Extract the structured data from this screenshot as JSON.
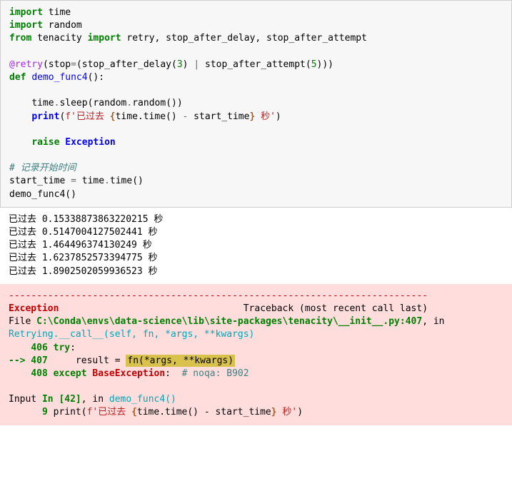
{
  "code": {
    "l1": {
      "import": "import",
      "mod": "time"
    },
    "l2": {
      "import": "import",
      "mod": "random"
    },
    "l3": {
      "from": "from",
      "mod": "tenacity",
      "import": "import",
      "names": "retry, stop_after_delay, stop_after_attempt"
    },
    "l5": {
      "decor": "@retry",
      "p1": "(stop",
      "eq": "=",
      "p2": "(stop_after_delay(",
      "n1": "3",
      "p3": ") ",
      "bar": "|",
      "p4": " stop_after_attempt(",
      "n2": "5",
      "p5": ")))"
    },
    "l6": {
      "def": "def",
      "fn": "demo_func4",
      "rest": "():"
    },
    "l8": {
      "a": "time",
      "d1": ".",
      "b": "sleep",
      "p1": "(random",
      "d2": ".",
      "c": "random",
      "p2": "())"
    },
    "l9": {
      "a": "print",
      "p": "(",
      "f": "f'",
      "s1": "已过去 ",
      "sb1": "{",
      "e": "time.time() ",
      "op": "-",
      "e2": " start_time",
      "sb2": "}",
      "s2": " 秒'",
      "p2": ")"
    },
    "l11": {
      "raise": "raise",
      "exc": "Exception"
    },
    "l13": {
      "cmt": "# 记录开始时间"
    },
    "l14": {
      "a": "start_time ",
      "op": "=",
      "b": " time",
      "d": ".",
      "c": "time",
      "p": "()"
    },
    "l15": {
      "call": "demo_func4()"
    }
  },
  "output": {
    "lines": [
      "已过去 0.15338873863220215 秒",
      "已过去 0.5147004127502441 秒",
      "已过去 1.464496374130249 秒",
      "已过去 1.6237852573394775 秒",
      "已过去 1.8902502059936523 秒"
    ]
  },
  "error": {
    "dashes": "---------------------------------------------------------------------------",
    "exc_name": "Exception",
    "tb_label": "Traceback (most recent call last)",
    "file_pre": "File ",
    "file_path": "C:\\Conda\\envs\\data-science\\lib\\site-packages\\tenacity\\__init__.py:407",
    "file_post": ", in ",
    "func_sig": "Retrying.__call__(self, fn, *args, **kwargs)",
    "l406": {
      "no": "    406 ",
      "kw": "try",
      "colon": ":"
    },
    "l407": {
      "arrow": "--> 407",
      "pre": "     result = ",
      "hl": "fn(*args, **kwargs)"
    },
    "l408": {
      "no": "    408 ",
      "kw": "except",
      "sp": " ",
      "exc": "BaseException",
      "colon": ":",
      "cmt": "  # noqa: B902"
    },
    "input_pre": "Input ",
    "input_in": "In [42]",
    "input_post": ", in ",
    "input_fn": "demo_func4",
    "input_fn_post": "()",
    "l9e": {
      "no": "      9 ",
      "a": "print",
      "p": "(",
      "f": "f'",
      "s1": "已过去 ",
      "sb1": "{",
      "e": "time.time() ",
      "op": "-",
      "e2": " start_time",
      "sb2": "}",
      "s2": " 秒'",
      "p2": ")"
    }
  }
}
